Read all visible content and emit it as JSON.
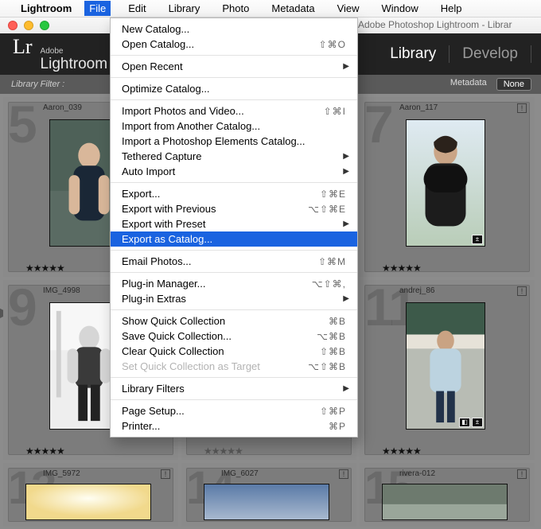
{
  "menubar": {
    "app": "Lightroom",
    "items": [
      "File",
      "Edit",
      "Library",
      "Photo",
      "Metadata",
      "View",
      "Window",
      "Help"
    ],
    "active": "File"
  },
  "window": {
    "title": "Adobe Photoshop Lightroom - Librar"
  },
  "lr": {
    "logo": {
      "mark": "Lr",
      "adobe": "Adobe",
      "product": "Lightroom"
    },
    "modules": {
      "library": "Library",
      "develop": "Develop"
    }
  },
  "filter": {
    "label": "Library Filter :",
    "tabs": {
      "metadata": "Metadata",
      "none": "None"
    }
  },
  "grid": {
    "cells": [
      {
        "num": "5",
        "fname": "Aaron_039",
        "stars": "★★★★★",
        "flag": "!",
        "narrow": true
      },
      {
        "num": "7",
        "fname": "Aaron_117",
        "stars": "★★★★★",
        "flag": "!",
        "narrow": true,
        "corner": true
      },
      {
        "num": "9",
        "fname": "IMG_4998",
        "stars": "★★★★★",
        "flag": "!",
        "narrow": true
      },
      {
        "num": "11",
        "fname": "andrej_86",
        "stars": "★★★★★",
        "flag": "!",
        "narrow": true,
        "corner2": true
      },
      {
        "num": "13",
        "fname": "IMG_5972",
        "stars": "",
        "flag": "!"
      },
      {
        "num": "14",
        "fname": "IMG_6027",
        "stars": "",
        "flag": "!"
      },
      {
        "num": "15",
        "fname": "rivera-012",
        "stars": "",
        "flag": "!"
      }
    ],
    "hidden_stars": "★★★★★"
  },
  "menu": {
    "items": [
      {
        "label": "New Catalog..."
      },
      {
        "label": "Open Catalog...",
        "shortcut": "⇧⌘O"
      },
      {
        "sep": true
      },
      {
        "label": "Open Recent",
        "submenu": true
      },
      {
        "sep": true
      },
      {
        "label": "Optimize Catalog..."
      },
      {
        "sep": true
      },
      {
        "label": "Import Photos and Video...",
        "shortcut": "⇧⌘I"
      },
      {
        "label": "Import from Another Catalog..."
      },
      {
        "label": "Import a Photoshop Elements Catalog..."
      },
      {
        "label": "Tethered Capture",
        "submenu": true
      },
      {
        "label": "Auto Import",
        "submenu": true
      },
      {
        "sep": true
      },
      {
        "label": "Export...",
        "shortcut": "⇧⌘E"
      },
      {
        "label": "Export with Previous",
        "shortcut": "⌥⇧⌘E"
      },
      {
        "label": "Export with Preset",
        "submenu": true
      },
      {
        "label": "Export as Catalog...",
        "highlight": true
      },
      {
        "sep": true
      },
      {
        "label": "Email Photos...",
        "shortcut": "⇧⌘M"
      },
      {
        "sep": true
      },
      {
        "label": "Plug-in Manager...",
        "shortcut": "⌥⇧⌘,"
      },
      {
        "label": "Plug-in Extras",
        "submenu": true
      },
      {
        "sep": true
      },
      {
        "label": "Show Quick Collection",
        "shortcut": "⌘B"
      },
      {
        "label": "Save Quick Collection...",
        "shortcut": "⌥⌘B"
      },
      {
        "label": "Clear Quick Collection",
        "shortcut": "⇧⌘B"
      },
      {
        "label": "Set Quick Collection as Target",
        "shortcut": "⌥⇧⌘B",
        "disabled": true
      },
      {
        "sep": true
      },
      {
        "label": "Library Filters",
        "submenu": true
      },
      {
        "sep": true
      },
      {
        "label": "Page Setup...",
        "shortcut": "⇧⌘P"
      },
      {
        "label": "Printer...",
        "shortcut": "⌘P"
      }
    ]
  }
}
